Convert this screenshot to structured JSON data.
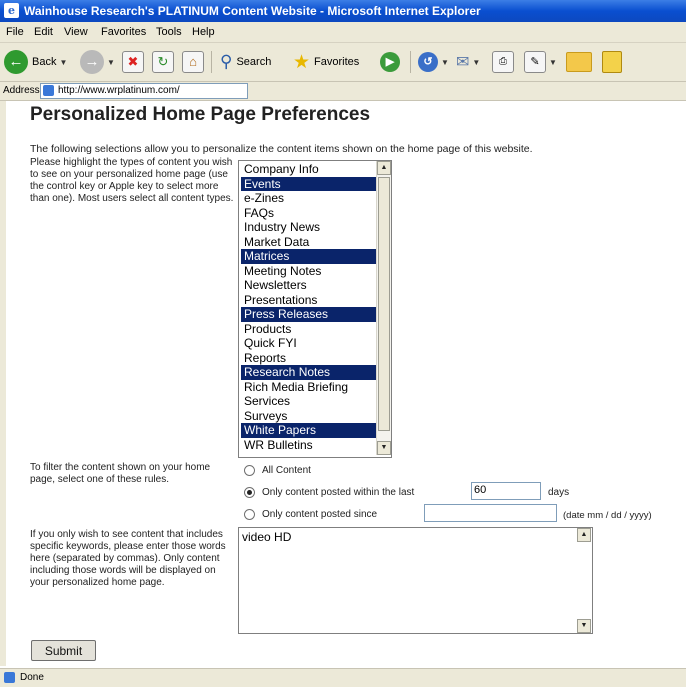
{
  "window": {
    "title": "Wainhouse Research's PLATINUM Content Website - Microsoft Internet Explorer"
  },
  "menu": [
    "File",
    "Edit",
    "View",
    "Favorites",
    "Tools",
    "Help"
  ],
  "toolbar": {
    "back_label": "Back",
    "search_label": "Search",
    "favorites_label": "Favorites"
  },
  "address": {
    "label": "Address",
    "url": "http://www.wrplatinum.com/"
  },
  "page": {
    "title": "Personalized Home Page Preferences",
    "intro": "The following selections allow you to personalize the content items shown on the home page of this website.",
    "content_types_help": "Please highlight the types of content you wish to see on your personalized home page (use the control key or Apple key to select more than one). Most users select all content types.",
    "content_types": [
      {
        "label": "Company Info",
        "selected": false
      },
      {
        "label": "Events",
        "selected": true
      },
      {
        "label": "e-Zines",
        "selected": false
      },
      {
        "label": "FAQs",
        "selected": false
      },
      {
        "label": "Industry News",
        "selected": false
      },
      {
        "label": "Market Data",
        "selected": false
      },
      {
        "label": "Matrices",
        "selected": true
      },
      {
        "label": "Meeting Notes",
        "selected": false
      },
      {
        "label": "Newsletters",
        "selected": false
      },
      {
        "label": "Presentations",
        "selected": false
      },
      {
        "label": "Press Releases",
        "selected": true
      },
      {
        "label": "Products",
        "selected": false
      },
      {
        "label": "Quick FYI",
        "selected": false
      },
      {
        "label": "Reports",
        "selected": false
      },
      {
        "label": "Research Notes",
        "selected": true
      },
      {
        "label": "Rich Media Briefing",
        "selected": false
      },
      {
        "label": "Services",
        "selected": false
      },
      {
        "label": "Surveys",
        "selected": false
      },
      {
        "label": "White Papers",
        "selected": true
      },
      {
        "label": "WR Bulletins",
        "selected": false
      }
    ],
    "filter_help": "To filter the content shown on your home page, select one of these rules.",
    "filter": {
      "all_label": "All Content",
      "within_label": "Only content posted within the last",
      "days_value": "60",
      "days_unit": "days",
      "since_label": "Only content posted since",
      "since_value": "",
      "date_hint": "(date mm / dd / yyyy)",
      "selected": "within"
    },
    "keywords_help": "If you only wish to see content that includes specific keywords, please enter those words here (separated by commas). Only content including those words will be displayed on your personalized home page.",
    "keywords_value": "video HD",
    "submit_label": "Submit"
  },
  "status": {
    "text": "Done"
  },
  "colors": {
    "selection": "#0a246a",
    "titlebar": "#0a4fd0",
    "chrome": "#ece9d8"
  }
}
